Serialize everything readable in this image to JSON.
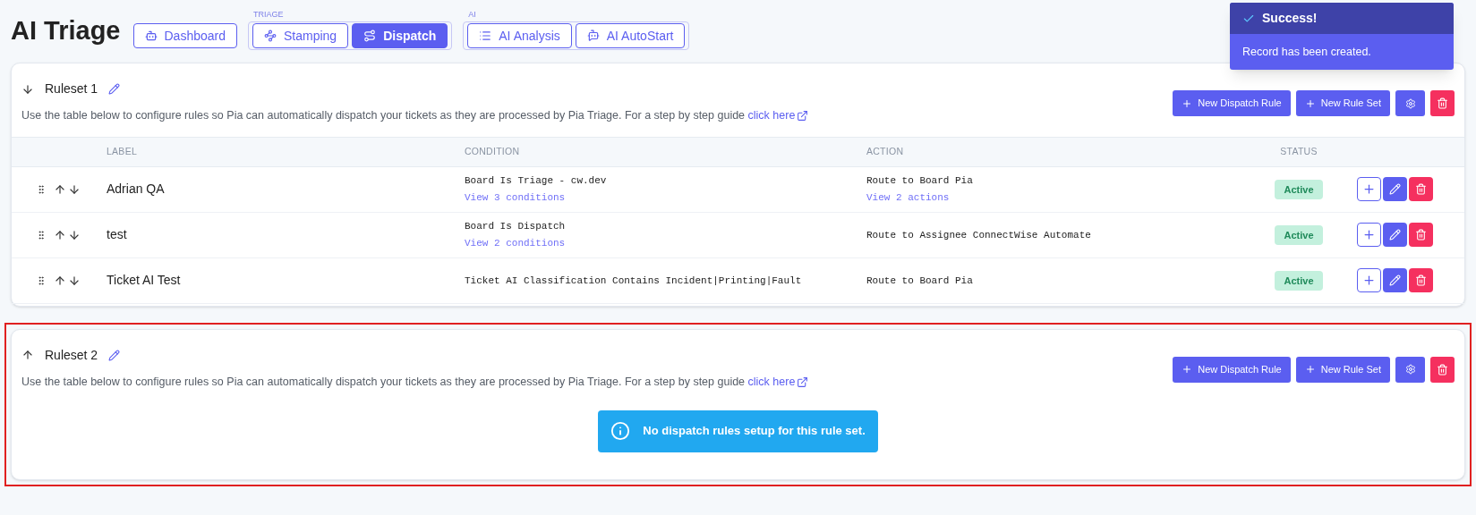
{
  "page_title": "AI Triage",
  "nav_groups": [
    {
      "tabs": [
        {
          "label": "Dashboard",
          "selected": false
        }
      ]
    },
    {
      "heading": "TRIAGE",
      "tabs": [
        {
          "label": "Stamping",
          "selected": false
        },
        {
          "label": "Dispatch",
          "selected": true
        }
      ]
    },
    {
      "heading": "AI",
      "tabs": [
        {
          "label": "AI Analysis",
          "selected": false
        },
        {
          "label": "AI AutoStart",
          "selected": false
        }
      ]
    }
  ],
  "toast": {
    "title": "Success!",
    "message": "Record has been created."
  },
  "rulesets": [
    {
      "name": "Ruleset 1",
      "move_down": true,
      "highlighted": false,
      "description": "Use the table below to configure rules so Pia can automatically dispatch your tickets as they are processed by Pia Triage. For a step by step guide ",
      "link": "click here",
      "buttons": [
        "New Dispatch Rule",
        "New Rule Set"
      ],
      "table": {
        "columns": [
          "LABEL",
          "CONDITION",
          "ACTION",
          "STATUS"
        ],
        "rows": [
          {
            "label": "Adrian QA",
            "condition": "Board Is Triage - cw.dev",
            "condition_link": "View 3 conditions",
            "action": "Route to Board Pia",
            "action_link": "View 2 actions",
            "status": "Active"
          },
          {
            "label": "test",
            "condition": "Board Is Dispatch",
            "condition_link": "View 2 conditions",
            "action": "Route to Assignee ConnectWise Automate",
            "status": "Active"
          },
          {
            "label": "Ticket AI Test",
            "condition": "Ticket AI Classification Contains Incident|Printing|Fault",
            "action": "Route to Board Pia",
            "status": "Active"
          }
        ]
      }
    },
    {
      "name": "Ruleset 2",
      "move_down": false,
      "highlighted": true,
      "description": "Use the table below to configure rules so Pia can automatically dispatch your tickets as they are processed by Pia Triage. For a step by step guide ",
      "link": "click here",
      "buttons": [
        "New Dispatch Rule",
        "New Rule Set"
      ],
      "empty_message": "No dispatch rules setup for this rule set."
    }
  ]
}
